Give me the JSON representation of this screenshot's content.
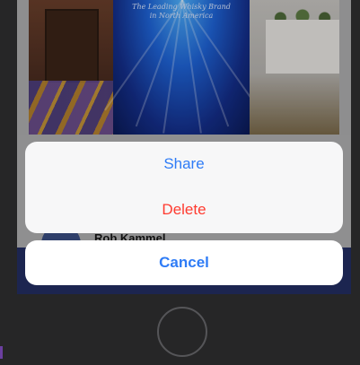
{
  "photo": {
    "banner_text": "The Leading Whisky Brand\nin North America"
  },
  "post": {
    "author_name": "Rob Kammel"
  },
  "action_sheet": {
    "share_label": "Share",
    "delete_label": "Delete",
    "cancel_label": "Cancel"
  },
  "colors": {
    "accent": "#2f7cf6",
    "destructive": "#ff3b30",
    "sheet_background": "#f7f7f8",
    "device_bezel": "#262627"
  },
  "device": {
    "home_button_icon": "home-button-icon"
  }
}
